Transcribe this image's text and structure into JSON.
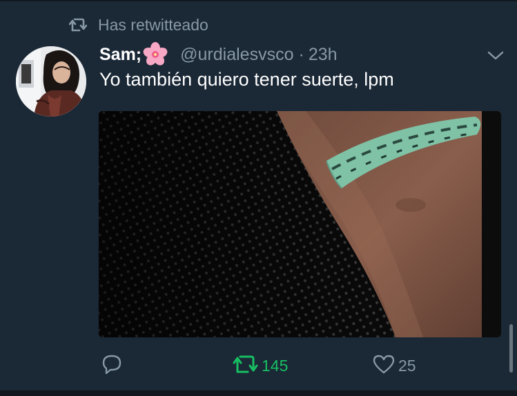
{
  "retweet_context": {
    "icon": "retweet-icon",
    "label": "Has retwitteado"
  },
  "tweet": {
    "author_name": "Sam;",
    "author_emoji": "cherry-blossom-icon",
    "handle": "@urdialesvsco",
    "separator": "·",
    "time": "23h",
    "text": "Yo también quiero tener suerte, lpm",
    "media_description_icon": "photo"
  },
  "actions": {
    "reply": {
      "icon": "reply-icon",
      "count": ""
    },
    "retweet": {
      "icon": "retweet-icon",
      "count": "145",
      "active": true
    },
    "like": {
      "icon": "heart-icon",
      "count": "25"
    }
  },
  "colors": {
    "background": "#1b2836",
    "secondary_text": "#8899a6",
    "retweet_active": "#17bf63",
    "primary_text": "#ffffff"
  }
}
